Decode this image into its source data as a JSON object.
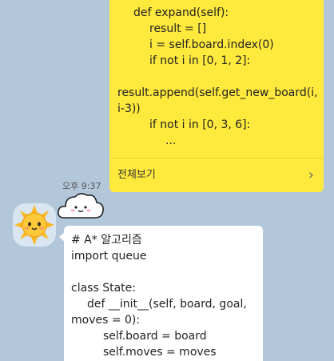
{
  "outgoing": {
    "lines": [
      "def expand(self):",
      "result = []",
      "i = self.board.index(0)",
      "if not i in [0, 1, 2]:",
      "",
      "result.append(self.get_new_board(i, i-3))",
      "if not i in [0, 3, 6]:",
      "..."
    ],
    "view_all_label": "전체보기",
    "chevron": "›"
  },
  "timestamp": "오후 9:37",
  "incoming": {
    "avatar_icon": "sun-face-icon",
    "emoji_icon": "cloud-face-icon",
    "lines": [
      "# A* 알고리즘",
      "import queue",
      "",
      "class State:",
      "def __init__(self, board, goal,",
      "moves = 0):",
      "self.board = board",
      "self.moves = moves"
    ]
  },
  "colors": {
    "background": "#b2c7d9",
    "outgoing_bubble": "#fee93c",
    "incoming_bubble": "#ffffff",
    "sun": "#f9b920"
  }
}
